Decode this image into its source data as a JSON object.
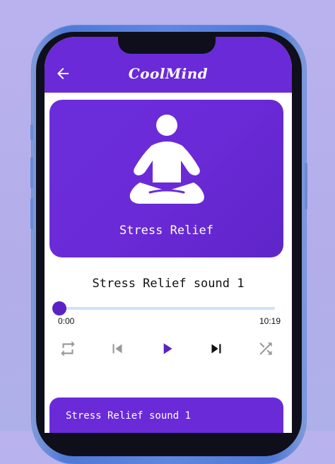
{
  "app": {
    "title": "CoolMind"
  },
  "hero": {
    "label": "Stress Relief",
    "icon": "meditation-icon"
  },
  "player": {
    "track_title": "Stress Relief sound 1",
    "progress": 0.0,
    "time_elapsed": "0:00",
    "time_total": "10:19",
    "controls": [
      "repeat-icon",
      "previous-icon",
      "play-icon",
      "next-icon",
      "shuffle-icon"
    ]
  },
  "playlist": {
    "items": [
      {
        "label": "Stress Relief sound 1"
      }
    ]
  },
  "colors": {
    "accent": "#6a2ad8",
    "background": "#b9b2ee",
    "seek_track": "#cfe2f8"
  }
}
